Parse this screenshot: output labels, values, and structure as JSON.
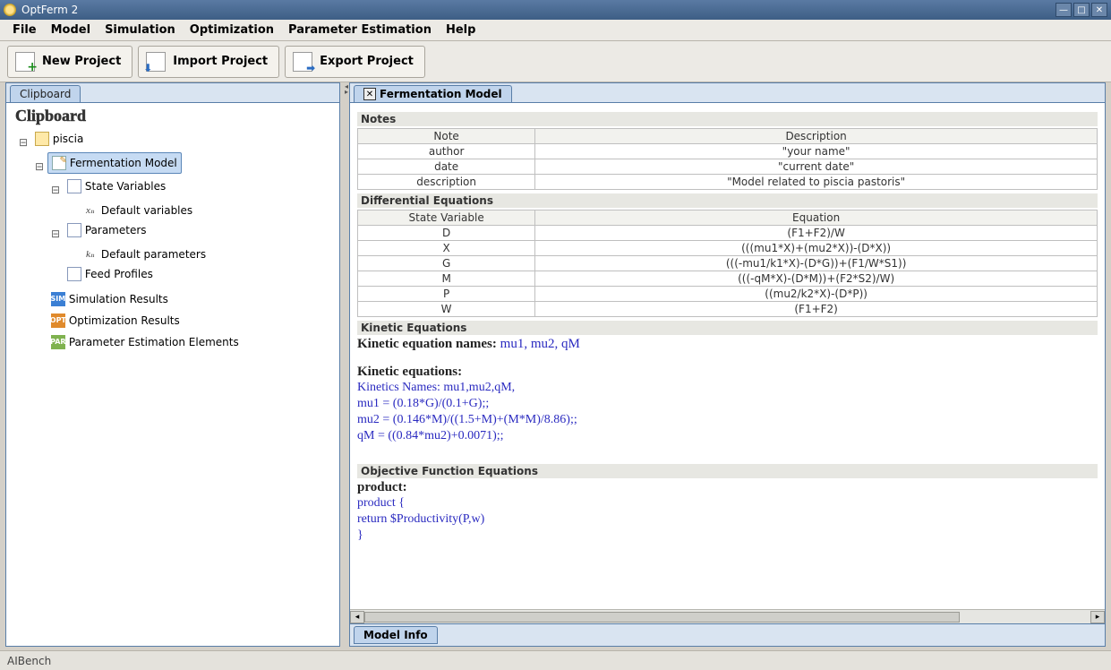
{
  "window": {
    "title": "OptFerm 2"
  },
  "menu": {
    "items": [
      "File",
      "Model",
      "Simulation",
      "Optimization",
      "Parameter Estimation",
      "Help"
    ]
  },
  "toolbar": {
    "new_project": "New Project",
    "import_project": "Import Project",
    "export_project": "Export Project"
  },
  "sidebar": {
    "tab_label": "Clipboard",
    "header": "Clipboard",
    "project": "piscia",
    "fermentation_model": "Fermentation Model",
    "state_variables": "State Variables",
    "default_variables": "Default variables",
    "parameters": "Parameters",
    "default_parameters": "Default parameters",
    "feed_profiles": "Feed Profiles",
    "simulation_results": "Simulation Results",
    "optimization_results": "Optimization Results",
    "parameter_estimation_elements": "Parameter Estimation Elements"
  },
  "editor": {
    "tab_label": "Fermentation Model",
    "bottom_tab": "Model Info",
    "sections": {
      "notes": "Notes",
      "diff_eq": "Differential Equations",
      "kinetic": "Kinetic Equations",
      "obj_fn": "Objective Function Equations"
    },
    "notes_table": {
      "headers": [
        "Note",
        "Description"
      ],
      "rows": [
        [
          "author",
          "\"your name\""
        ],
        [
          "date",
          "\"current date\""
        ],
        [
          "description",
          "\"Model related to piscia pastoris\""
        ]
      ]
    },
    "diff_table": {
      "headers": [
        "State Variable",
        "Equation"
      ],
      "rows": [
        [
          "D",
          "(F1+F2)/W"
        ],
        [
          "X",
          "(((mu1*X)+(mu2*X))-(D*X))"
        ],
        [
          "G",
          "(((-mu1/k1*X)-(D*G))+(F1/W*S1))"
        ],
        [
          "M",
          "(((-qM*X)-(D*M))+(F2*S2)/W)"
        ],
        [
          "P",
          "((mu2/k2*X)-(D*P))"
        ],
        [
          "W",
          "(F1+F2)"
        ]
      ]
    },
    "kinetic": {
      "names_label": "Kinetic equation names:",
      "names_values": "mu1, mu2, qM",
      "equations_label": "Kinetic equations:",
      "lines": [
        "Kinetics Names: mu1,mu2,qM,",
        "mu1 = (0.18*G)/(0.1+G);;",
        "mu2 = (0.146*M)/((1.5+M)+(M*M)/8.86);;",
        "qM = ((0.84*mu2)+0.0071);;"
      ]
    },
    "objective": {
      "label": "product:",
      "lines": [
        "product    {",
        "return $Productivity(P,w)",
        "}"
      ]
    }
  },
  "statusbar": {
    "text": "AIBench"
  }
}
